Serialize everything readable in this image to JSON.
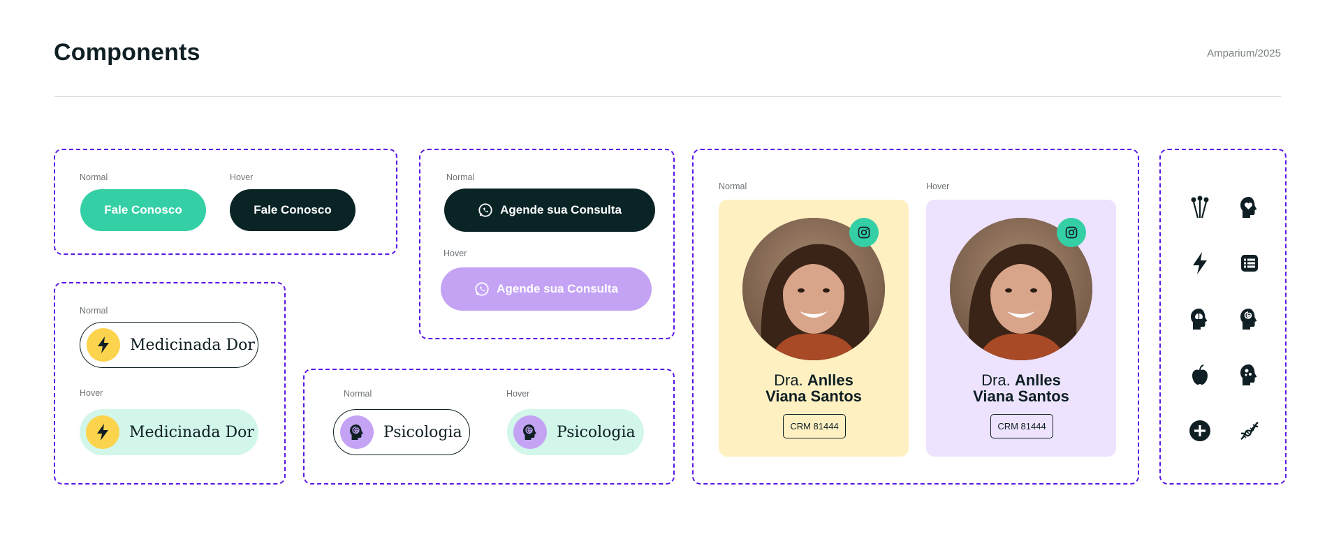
{
  "header": {
    "title": "Components",
    "credit": "Amparium/2025"
  },
  "colors": {
    "accent_green": "#35cfa6",
    "dark": "#0a2426",
    "lavender": "#c4a3f5",
    "mint": "#d2f6ea",
    "dashed_border": "#5a17e6",
    "card_yellow": "#fff0c2",
    "card_lavender": "#ede3ff",
    "bolt_yellow": "#fcd34d"
  },
  "contact_buttons": {
    "normal_label": "Normal",
    "hover_label": "Hover",
    "normal_text": "Fale Conosco",
    "hover_text": "Fale Conosco"
  },
  "schedule_buttons": {
    "normal_label": "Normal",
    "hover_label": "Hover",
    "normal_text": "Agende sua Consulta",
    "hover_text": "Agende sua Consulta",
    "icon": "whatsapp-icon"
  },
  "specialty_tag_pain": {
    "normal_label": "Normal",
    "hover_label": "Hover",
    "text": "Medicinada Dor",
    "icon": "lightning-icon"
  },
  "specialty_tag_psych": {
    "normal_label": "Normal",
    "hover_label": "Hover",
    "text": "Psicologia",
    "icon": "mind-head-icon"
  },
  "doctor_cards": {
    "normal_label": "Normal",
    "hover_label": "Hover",
    "prefix": "Dra.",
    "name_line1": "Anlles",
    "name_line2": "Viana Santos",
    "crm": "CRM 81444",
    "social_icon": "instagram-icon"
  },
  "icon_set": [
    "acupuncture-icon",
    "head-heart-icon",
    "lightning-icon",
    "list-icon",
    "head-brain-icon",
    "head-spiral-icon",
    "apple-icon",
    "head-puzzle-icon",
    "plus-circle-icon",
    "dna-icon"
  ]
}
